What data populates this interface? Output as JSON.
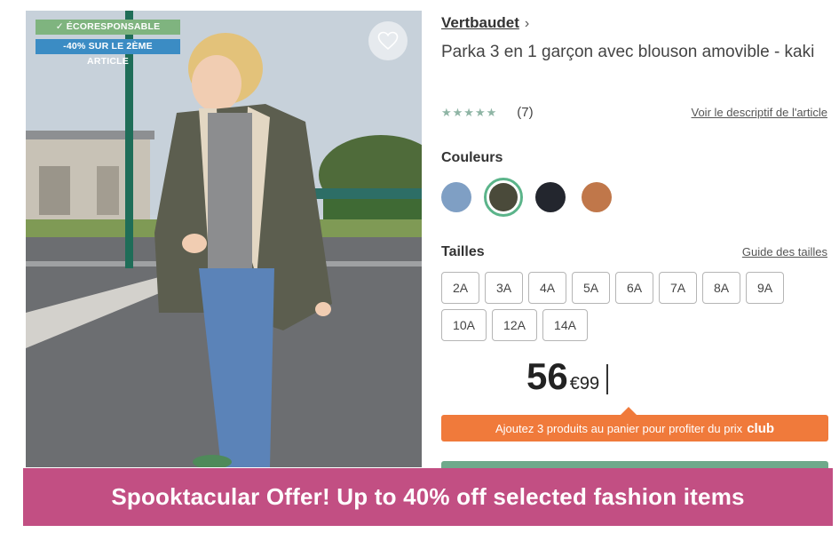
{
  "photo": {
    "badges": {
      "eco": "✓ ÉCORESPONSABLE",
      "promo": "-40% SUR LE 2ÈME ARTICLE"
    },
    "favorite_icon": "heart-outline-icon"
  },
  "product": {
    "brand": "Vertbaudet",
    "brand_chevron": "›",
    "title": "Parka 3 en 1 garçon avec blouson amovible - kaki",
    "rating": {
      "stars": "★★★★★",
      "value": 4.5,
      "count": "(7)"
    },
    "description_link": "Voir le descriptif de l'article"
  },
  "colors": {
    "label": "Couleurs",
    "swatches": [
      {
        "name": "bleu",
        "hex": "#7f9fc4",
        "selected": false
      },
      {
        "name": "kaki",
        "hex": "#4a4a3a",
        "selected": true
      },
      {
        "name": "marine",
        "hex": "#23262e",
        "selected": false
      },
      {
        "name": "camel",
        "hex": "#c0774a",
        "selected": false
      }
    ]
  },
  "sizes": {
    "label": "Tailles",
    "guide_link": "Guide des tailles",
    "options": [
      "2A",
      "3A",
      "4A",
      "5A",
      "6A",
      "7A",
      "8A",
      "9A",
      "10A",
      "12A",
      "14A"
    ]
  },
  "price": {
    "integer": "56",
    "decimal": "€99"
  },
  "club_banner": {
    "text": "Ajoutez 3 produits au panier pour profiter du prix",
    "highlight": "club",
    "color": "#f07a3b"
  },
  "offer_banner": {
    "text": "Spooktacular Offer! Up to 40% off selected fashion items",
    "color": "#c24f83"
  },
  "accent_colors": {
    "selected_ring": "#5bb48a",
    "cta_green": "#6fa98b"
  }
}
